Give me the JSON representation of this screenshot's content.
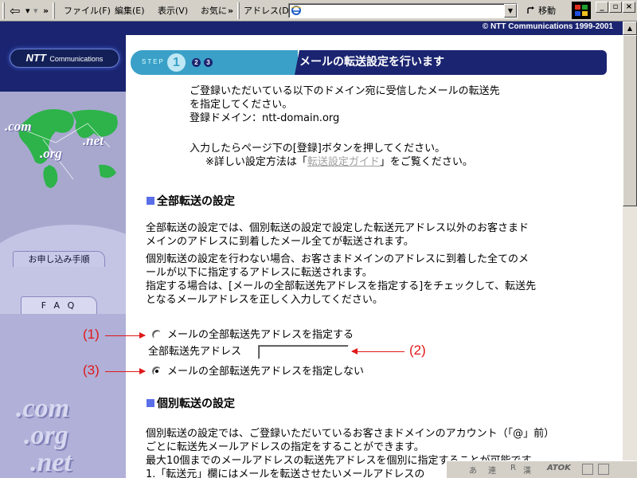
{
  "toolbar": {
    "back_arrow": "⇦",
    "back_drop": "▾",
    "fwd_drop": "▾",
    "chevron1": "»",
    "menus": [
      "ファイル(F)",
      "編集(E)",
      "表示(V)",
      "お気に"
    ],
    "chevron2": "»",
    "address_label": "アドレス(D)",
    "address_value": "",
    "go_label": "移動"
  },
  "sidebar": {
    "logo_big": "NTT",
    "logo_small": "Communications",
    "map_words": [
      ".com",
      ".org",
      ".net"
    ],
    "apply_tab": "お申し込み手順",
    "faq_tab": "F A Q",
    "lower_words": [
      ".com",
      ".org",
      ".net"
    ]
  },
  "main": {
    "copyright": "© NTT Communications 1999-2001",
    "step": {
      "label": "STEP",
      "current": "1",
      "next": [
        "2",
        "3"
      ],
      "title": "メールの転送設定を行います"
    },
    "intro": [
      "ご登録いただいている以下のドメイン宛に受信したメールの転送先",
      "を指定してください。",
      "登録ドメイン：ntt-domain.org"
    ],
    "instruct1": "入力したらページ下の[登録]ボタンを押してください。",
    "instruct2_pre": "※詳しい設定方法は「",
    "instruct2_link": "転送設定ガイド",
    "instruct2_post": "」をご覧ください。",
    "section1_title": "全部転送の設定",
    "section1_para": [
      "全部転送の設定では、個別転送の設定で設定した転送元アドレス以外のお客さまド",
      "メインのアドレスに到着したメール全てが転送されます。",
      "個別転送の設定を行わない場合、お客さまドメインのアドレスに到着した全てのメ",
      "ールが以下に指定するアドレスに転送されます。",
      "指定する場合は、[メールの全部転送先アドレスを指定する]をチェックして、転送先",
      "となるメールアドレスを正しく入力してください。"
    ],
    "radio_specify": "メールの全部転送先アドレスを指定する",
    "field_label": "全部転送先アドレス",
    "field_value": "",
    "radio_no_specify": "メールの全部転送先アドレスを指定しない",
    "section2_title": "個別転送の設定",
    "section2_para": [
      "個別転送の設定では、ご登録いただいているお客さまドメインのアカウント（「@」前）",
      "ごとに転送先メールアドレスの指定をすることができます。",
      "最大10個までのメールアドレスの転送先アドレスを個別に指定することが可能です。",
      "1.「転送元」欄にはメールを転送させたいメールアドレスの"
    ]
  },
  "annotations": {
    "a1": "(1)",
    "a2": "(2)",
    "a3": "(3)",
    "color": "#e01818"
  },
  "imebar": {
    "items": [
      "あ",
      "連",
      "R",
      "漢",
      "ATOK"
    ]
  },
  "colors": {
    "navy": "#1a2470",
    "teal": "#3aa0c8",
    "heading_square": "#5a6ee8",
    "sidebar": "#a8a8cf"
  }
}
